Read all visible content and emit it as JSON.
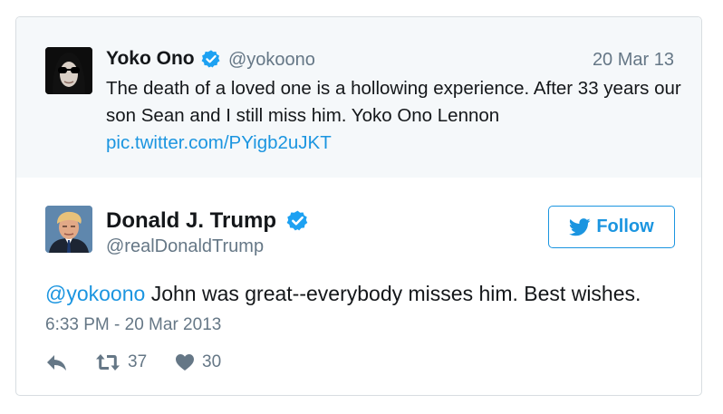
{
  "quoted_tweet": {
    "name": "Yoko Ono",
    "handle": "@yokoono",
    "date": "20 Mar 13",
    "text": "The death of a loved one is a hollowing experience. After 33 years our son Sean and I still miss him. Yoko Ono Lennon",
    "link": "pic.twitter.com/PYigb2uJKT",
    "avatar_icon": "avatar-woman-sunglasses"
  },
  "tweet": {
    "name": "Donald J. Trump",
    "handle": "@realDonaldTrump",
    "follow_label": "Follow",
    "mention": "@yokoono",
    "text": " John was great--everybody misses him. Best wishes.",
    "timestamp": "6:33 PM - 20 Mar 2013",
    "retweets": "37",
    "likes": "30",
    "avatar_icon": "avatar-man-portrait"
  },
  "colors": {
    "accent": "#1b95e0",
    "muted": "#657786",
    "text": "#14171a",
    "quoted_bg": "#f5f8fa",
    "border": "#d8dde1"
  }
}
